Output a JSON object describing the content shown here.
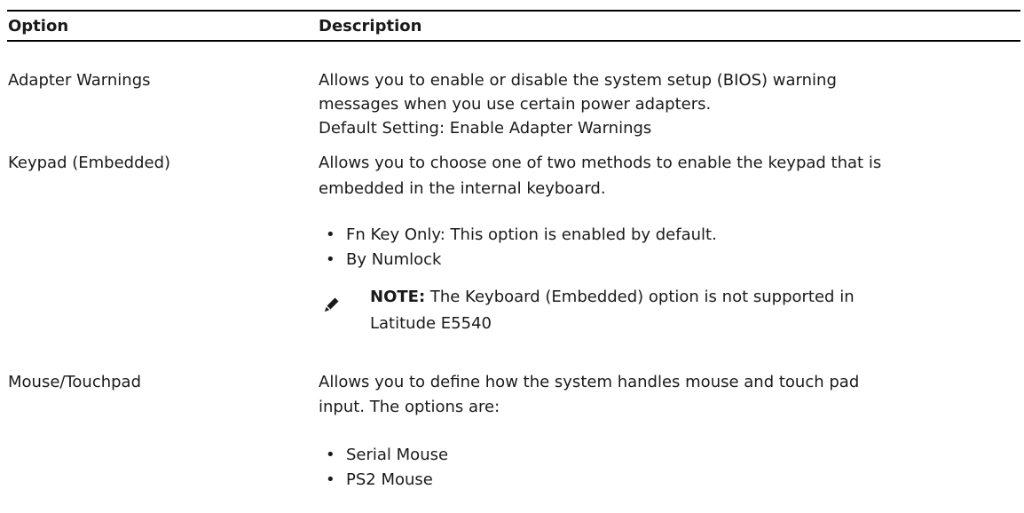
{
  "header": {
    "option": "Option",
    "description": "Description"
  },
  "rows": [
    {
      "option": "Adapter Warnings",
      "desc_lines": [
        "Allows you to enable or disable the system setup (BIOS) warning",
        "messages when you use certain power adapters.",
        "Default Setting: Enable Adapter Warnings"
      ]
    },
    {
      "option": "Keypad (Embedded)",
      "desc_lines": [
        "Allows you to choose one of two methods to enable the keypad that is",
        "embedded in the internal keyboard."
      ],
      "bullets": [
        "Fn Key Only: This option is enabled by default.",
        "By Numlock"
      ],
      "note": {
        "icon": "note-pencil-icon",
        "label": "NOTE:",
        "lines": [
          " The Keyboard (Embedded) option is not supported in",
          "Latitude E5540"
        ]
      }
    },
    {
      "option": "Mouse/Touchpad",
      "desc_lines": [
        "Allows you to define how the system handles mouse and touch pad",
        "input. The options are:"
      ],
      "bullets": [
        "Serial Mouse",
        "PS2 Mouse"
      ]
    }
  ],
  "bullet_char": "•"
}
